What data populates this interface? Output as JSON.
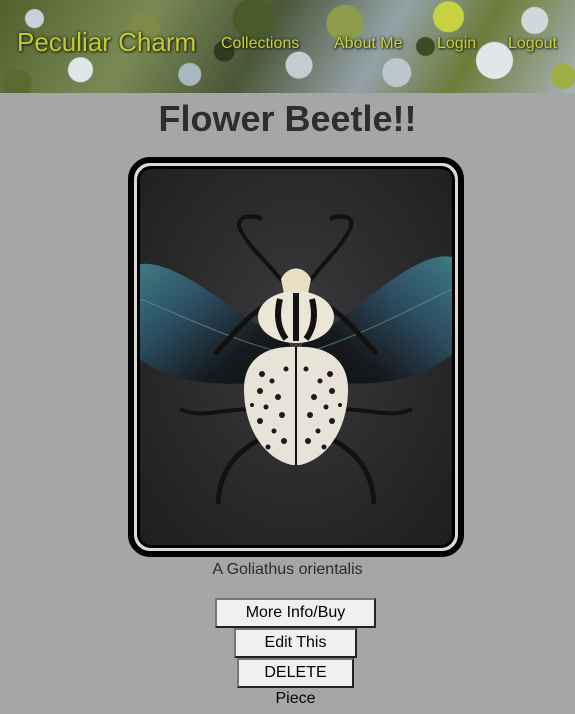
{
  "header": {
    "brand": "Peculiar Charm",
    "nav": [
      "Collections",
      "About Me",
      "Login",
      "Logout"
    ]
  },
  "main": {
    "title": "Flower Beetle!!",
    "caption": "A Goliathus orientalis",
    "buttons": {
      "more_info": "More Info/Buy Here!",
      "edit": "Edit This Piece",
      "delete": "DELETE Piece"
    }
  },
  "colors": {
    "page_background": "#a6a6a6",
    "nav_text": "#c9d03a",
    "frame_border": "#000000"
  }
}
